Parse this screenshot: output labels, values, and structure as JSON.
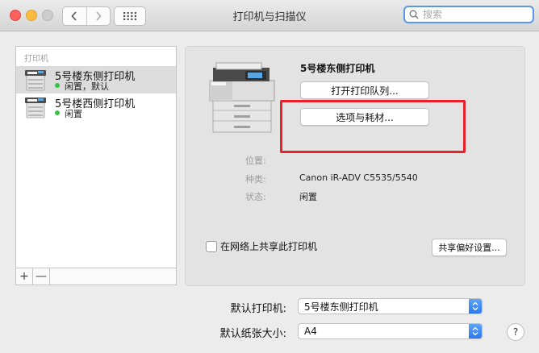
{
  "window": {
    "title": "打印机与扫描仪"
  },
  "search": {
    "placeholder": "搜索"
  },
  "printer_list": {
    "header": "打印机",
    "items": [
      {
        "name": "5号楼东侧打印机",
        "status": "闲置，默认"
      },
      {
        "name": "5号楼西侧打印机",
        "status": "闲置"
      }
    ],
    "add_label": "+",
    "remove_label": "—"
  },
  "detail": {
    "printer_name": "5号楼东侧打印机",
    "open_queue_label": "打开打印队列...",
    "options_label": "选项与耗材...",
    "location_label": "位置:",
    "location_value": "",
    "kind_label": "种类:",
    "kind_value": "Canon iR-ADV C5535/5540",
    "status_label": "状态:",
    "status_value": "闲置",
    "share_checkbox_label": "在网络上共享此打印机",
    "share_prefs_label": "共享偏好设置..."
  },
  "defaults": {
    "printer_label": "默认打印机:",
    "printer_value": "5号楼东侧打印机",
    "paper_label": "默认纸张大小:",
    "paper_value": "A4"
  },
  "help_label": "?",
  "colors": {
    "status_dot": "#37c441",
    "highlight_border": "#e8212a",
    "search_focus": "#5a97e6"
  }
}
